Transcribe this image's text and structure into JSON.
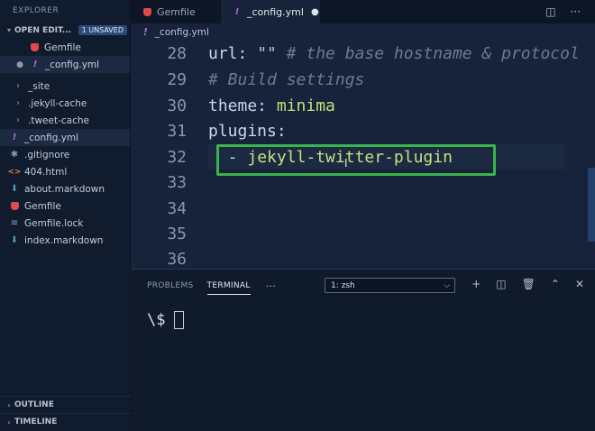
{
  "sidebar": {
    "title": "EXPLORER",
    "open_editors": {
      "label": "OPEN EDIT...",
      "badge": "1 UNSAVED",
      "items": [
        {
          "name": "Gemfile",
          "icon": "ruby-icon"
        },
        {
          "name": "_config.yml",
          "icon": "exclamation-icon"
        }
      ]
    },
    "files": [
      {
        "name": "_site",
        "icon": "chevron-right-icon"
      },
      {
        "name": ".jekyll-cache",
        "icon": "chevron-right-icon"
      },
      {
        "name": ".tweet-cache",
        "icon": "chevron-right-icon"
      },
      {
        "name": "_config.yml",
        "icon": "exclamation-icon"
      },
      {
        "name": ".gitignore",
        "icon": "gear-icon"
      },
      {
        "name": "404.html",
        "icon": "html-icon"
      },
      {
        "name": "about.markdown",
        "icon": "markdown-icon"
      },
      {
        "name": "Gemfile",
        "icon": "ruby-icon"
      },
      {
        "name": "Gemfile.lock",
        "icon": "lines-icon"
      },
      {
        "name": "index.markdown",
        "icon": "markdown-icon"
      }
    ],
    "outline_label": "OUTLINE",
    "timeline_label": "TIMELINE"
  },
  "tabs": [
    {
      "label": "Gemfile"
    },
    {
      "label": "_config.yml",
      "modified": "●"
    }
  ],
  "breadcrumb": {
    "file": "_config.yml"
  },
  "editor": {
    "lines": [
      {
        "num": "28",
        "key": "url: ",
        "str": "\"\"",
        "comment": " # the base hostname & protocol"
      },
      {
        "num": "29",
        "comment": "# Build settings"
      },
      {
        "num": "30",
        "key": "theme: ",
        "value": "minima"
      },
      {
        "num": "31",
        "key": "plugins:"
      },
      {
        "num": "32",
        "key": "  - ",
        "value": "jekyll-twitter-plugin"
      },
      {
        "num": "33"
      },
      {
        "num": "34"
      },
      {
        "num": "35"
      },
      {
        "num": "36"
      }
    ]
  },
  "panel": {
    "tabs": [
      "PROBLEMS",
      "TERMINAL"
    ],
    "more": "···",
    "terminal_select": "1: zsh",
    "prompt": "\\$"
  },
  "colors": {
    "highlight_box": "#3bb34a",
    "accent_badge": "#2b4a7b"
  }
}
